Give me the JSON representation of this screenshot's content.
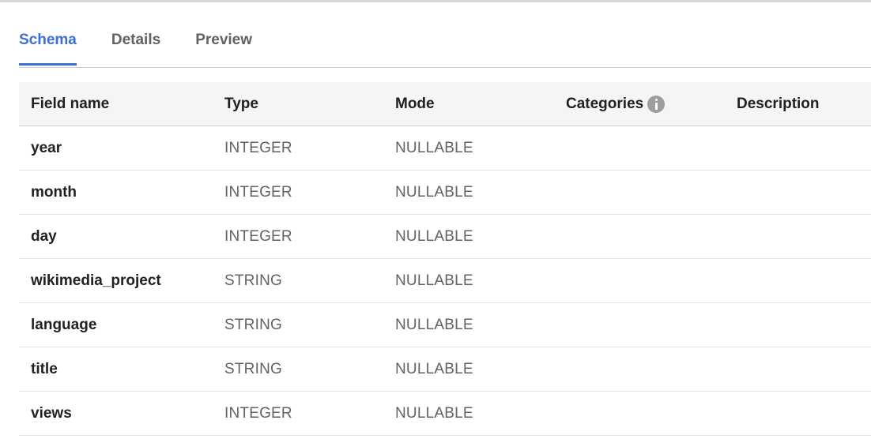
{
  "tabs": [
    {
      "label": "Schema",
      "active": true
    },
    {
      "label": "Details",
      "active": false
    },
    {
      "label": "Preview",
      "active": false
    }
  ],
  "colors": {
    "accent": "#3b6fd6",
    "header_bg": "#f5f5f5",
    "muted_text": "#5f6368",
    "info_icon": "#9e9e9e"
  },
  "table": {
    "headers": {
      "field_name": "Field name",
      "type": "Type",
      "mode": "Mode",
      "categories": "Categories",
      "description": "Description"
    },
    "categories_icon": "info-icon",
    "rows": [
      {
        "name": "year",
        "type": "INTEGER",
        "mode": "NULLABLE",
        "categories": "",
        "description": ""
      },
      {
        "name": "month",
        "type": "INTEGER",
        "mode": "NULLABLE",
        "categories": "",
        "description": ""
      },
      {
        "name": "day",
        "type": "INTEGER",
        "mode": "NULLABLE",
        "categories": "",
        "description": ""
      },
      {
        "name": "wikimedia_project",
        "type": "STRING",
        "mode": "NULLABLE",
        "categories": "",
        "description": ""
      },
      {
        "name": "language",
        "type": "STRING",
        "mode": "NULLABLE",
        "categories": "",
        "description": ""
      },
      {
        "name": "title",
        "type": "STRING",
        "mode": "NULLABLE",
        "categories": "",
        "description": ""
      },
      {
        "name": "views",
        "type": "INTEGER",
        "mode": "NULLABLE",
        "categories": "",
        "description": ""
      }
    ]
  }
}
